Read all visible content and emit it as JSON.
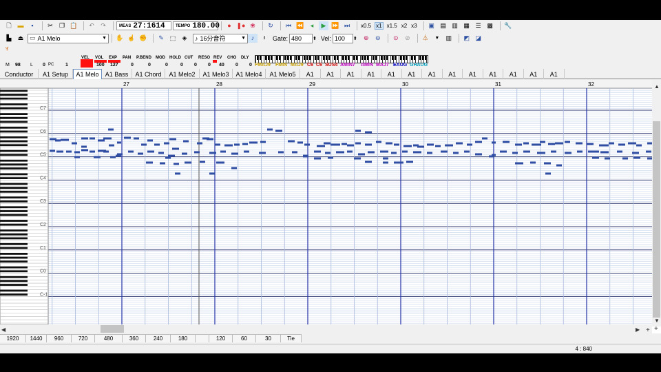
{
  "toolbar": {
    "meas_label": "MEAS",
    "position": "27:1614",
    "tempo_label": "TEMPO",
    "tempo": "180.00",
    "zoom_options": [
      "x0.5",
      "x1",
      "x1.5",
      "x2",
      "x3"
    ],
    "zoom_selected": "x1"
  },
  "track_select": {
    "value": "A1 Melo"
  },
  "note_length": {
    "value": "16分音符"
  },
  "gate": {
    "label": "Gate:",
    "value": "480"
  },
  "velocity": {
    "label": "Vel:",
    "value": "100"
  },
  "controllers": {
    "labels": [
      "VEL",
      "VOL",
      "EXP",
      "PAN",
      "P.BEND",
      "MOD",
      "HOLD",
      "CUT",
      "RESO",
      "REV",
      "CHO",
      "DLY"
    ],
    "values": [
      "",
      "100",
      "127",
      "0",
      "0",
      "0",
      "0",
      "0",
      "0",
      "40",
      "0",
      "0"
    ],
    "left": {
      "m_label": "M",
      "m_value": "98",
      "l_label": "L",
      "l_value": "0",
      "pc_label": "PC",
      "pc_value": "1"
    }
  },
  "chords": [
    {
      "text": "FMAJ9",
      "color": "#c8a000"
    },
    {
      "text": "FMIN",
      "color": "#c8a000"
    },
    {
      "text": "MAJ9",
      "color": "#c8a000"
    },
    {
      "text": "C6",
      "color": "#d00000"
    },
    {
      "text": "C6",
      "color": "#d00000"
    },
    {
      "text": "SUS4",
      "color": "#d00000"
    },
    {
      "text": "AMIN7",
      "color": "#c000c0"
    },
    {
      "text": "AMIN",
      "color": "#c000c0"
    },
    {
      "text": "MAJ7",
      "color": "#c000c0"
    },
    {
      "text": "EAUG",
      "color": "#0000c0"
    },
    {
      "text": "GHAUG",
      "color": "#00a0c0"
    }
  ],
  "tabs": [
    "Conductor",
    "A1 Setup",
    "A1 Melo",
    "A1 Bass",
    "A1 Chord",
    "A1 Melo2",
    "A1 Melo3",
    "A1 Melo4",
    "A1 Melo5",
    "A1",
    "A1",
    "A1",
    "A1",
    "A1",
    "A1",
    "A1",
    "A1",
    "A1",
    "A1",
    "A1",
    "A1",
    "A1"
  ],
  "active_tab": "A1 Melo",
  "roll": {
    "measures": [
      "27",
      "28",
      "29",
      "30",
      "31",
      "32"
    ],
    "octave_labels": [
      "C7",
      "C6",
      "C5",
      "C4",
      "C3",
      "C2",
      "C1",
      "C0",
      "C-1"
    ]
  },
  "zoom_bar": [
    "1920",
    "1440",
    "960",
    "720",
    "480",
    "360",
    "240",
    "180",
    "120",
    "60",
    "30",
    "Tie"
  ],
  "status": {
    "position": "4 : 840"
  },
  "colors": {
    "note": "#2f4ea3",
    "measure_line": "#2434a8",
    "record": "#e03030",
    "vel_bar": "#ff1010"
  }
}
